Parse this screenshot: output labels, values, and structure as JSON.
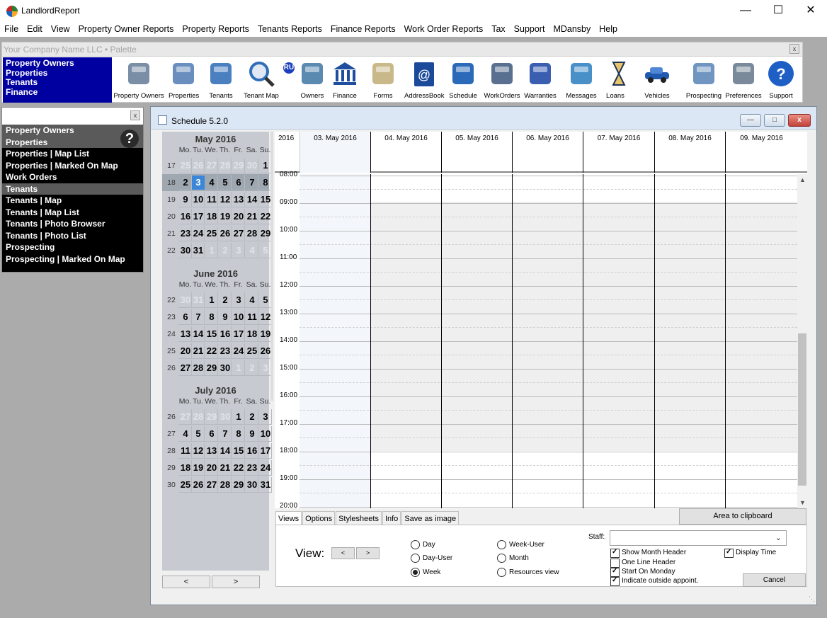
{
  "app": {
    "title": "LandlordReport",
    "minimize": "—",
    "maximize": "☐",
    "close": "✕"
  },
  "menu": [
    "File",
    "Edit",
    "View",
    "Property Owner Reports",
    "Property Reports",
    "Tenants Reports",
    "Finance Reports",
    "Work Order Reports",
    "Tax",
    "Support",
    "MDansby",
    "Help"
  ],
  "palette": {
    "title": "Your Company Name LLC  • Palette",
    "close": "x",
    "nav": [
      "Property Owners",
      "Properties",
      "Tenants",
      "Finance"
    ],
    "tools": [
      "Property Owners",
      "Properties",
      "Tenants",
      "Tenant Map",
      "RU",
      "Owners",
      "Finance",
      "Forms",
      "AddressBook",
      "Schedule",
      "WorkOrders",
      "Warranties",
      "Messages",
      "Loans",
      "Vehicles",
      "Prospecting",
      "Preferences",
      "Support"
    ]
  },
  "leftnav": {
    "close": "x",
    "help": "?",
    "items": [
      {
        "label": "Property Owners",
        "gray": true
      },
      {
        "label": "Properties",
        "gray": true
      },
      {
        "label": "Properties | Map List",
        "gray": false
      },
      {
        "label": "Properties | Marked On Map",
        "gray": false
      },
      {
        "label": "Work Orders",
        "gray": false
      },
      {
        "label": "Tenants",
        "gray": true
      },
      {
        "label": "Tenants | Map",
        "gray": false
      },
      {
        "label": "Tenants | Map List",
        "gray": false
      },
      {
        "label": "Tenants | Photo Browser",
        "gray": false
      },
      {
        "label": "Tenants | Photo List",
        "gray": false
      },
      {
        "label": "Prospecting",
        "gray": false
      },
      {
        "label": "Prospecting | Marked On Map",
        "gray": false
      }
    ]
  },
  "schedule": {
    "title": "Schedule 5.2.0",
    "win_min": "—",
    "win_max": "□",
    "win_close": "x",
    "dow": [
      "Mo.",
      "Tu.",
      "We.",
      "Th.",
      "Fr.",
      "Sa.",
      "Su."
    ],
    "months": [
      {
        "title": "May 2016",
        "weeks": [
          {
            "wk": "17",
            "days": [
              "25",
              "26",
              "27",
              "28",
              "29",
              "30",
              "1"
            ],
            "dim": [
              1,
              1,
              1,
              1,
              1,
              1,
              0
            ]
          },
          {
            "wk": "18",
            "days": [
              "2",
              "3",
              "4",
              "5",
              "6",
              "7",
              "8"
            ],
            "dim": [
              0,
              0,
              0,
              0,
              0,
              0,
              0
            ],
            "current": true,
            "today": 1
          },
          {
            "wk": "19",
            "days": [
              "9",
              "10",
              "11",
              "12",
              "13",
              "14",
              "15"
            ],
            "dim": [
              0,
              0,
              0,
              0,
              0,
              0,
              0
            ]
          },
          {
            "wk": "20",
            "days": [
              "16",
              "17",
              "18",
              "19",
              "20",
              "21",
              "22"
            ],
            "dim": [
              0,
              0,
              0,
              0,
              0,
              0,
              0
            ]
          },
          {
            "wk": "21",
            "days": [
              "23",
              "24",
              "25",
              "26",
              "27",
              "28",
              "29"
            ],
            "dim": [
              0,
              0,
              0,
              0,
              0,
              0,
              0
            ]
          },
          {
            "wk": "22",
            "days": [
              "30",
              "31",
              "1",
              "2",
              "3",
              "4",
              "5"
            ],
            "dim": [
              0,
              0,
              1,
              1,
              1,
              1,
              1
            ]
          }
        ]
      },
      {
        "title": "June 2016",
        "weeks": [
          {
            "wk": "22",
            "days": [
              "30",
              "31",
              "1",
              "2",
              "3",
              "4",
              "5"
            ],
            "dim": [
              1,
              1,
              0,
              0,
              0,
              0,
              0
            ]
          },
          {
            "wk": "23",
            "days": [
              "6",
              "7",
              "8",
              "9",
              "10",
              "11",
              "12"
            ],
            "dim": [
              0,
              0,
              0,
              0,
              0,
              0,
              0
            ]
          },
          {
            "wk": "24",
            "days": [
              "13",
              "14",
              "15",
              "16",
              "17",
              "18",
              "19"
            ],
            "dim": [
              0,
              0,
              0,
              0,
              0,
              0,
              0
            ]
          },
          {
            "wk": "25",
            "days": [
              "20",
              "21",
              "22",
              "23",
              "24",
              "25",
              "26"
            ],
            "dim": [
              0,
              0,
              0,
              0,
              0,
              0,
              0
            ]
          },
          {
            "wk": "26",
            "days": [
              "27",
              "28",
              "29",
              "30",
              "1",
              "2",
              "3"
            ],
            "dim": [
              0,
              0,
              0,
              0,
              1,
              1,
              1
            ]
          }
        ]
      },
      {
        "title": "July 2016",
        "weeks": [
          {
            "wk": "26",
            "days": [
              "27",
              "28",
              "29",
              "30",
              "1",
              "2",
              "3"
            ],
            "dim": [
              1,
              1,
              1,
              1,
              0,
              0,
              0
            ]
          },
          {
            "wk": "27",
            "days": [
              "4",
              "5",
              "6",
              "7",
              "8",
              "9",
              "10"
            ],
            "dim": [
              0,
              0,
              0,
              0,
              0,
              0,
              0
            ]
          },
          {
            "wk": "28",
            "days": [
              "11",
              "12",
              "13",
              "14",
              "15",
              "16",
              "17"
            ],
            "dim": [
              0,
              0,
              0,
              0,
              0,
              0,
              0
            ]
          },
          {
            "wk": "29",
            "days": [
              "18",
              "19",
              "20",
              "21",
              "22",
              "23",
              "24"
            ],
            "dim": [
              0,
              0,
              0,
              0,
              0,
              0,
              0
            ]
          },
          {
            "wk": "30",
            "days": [
              "25",
              "26",
              "27",
              "28",
              "29",
              "30",
              "31"
            ],
            "dim": [
              0,
              0,
              0,
              0,
              0,
              0,
              0
            ]
          }
        ]
      }
    ],
    "prev": "<",
    "next": ">",
    "year": "2016",
    "day_columns": [
      "03. May 2016",
      "04. May 2016",
      "05. May 2016",
      "06. May 2016",
      "07. May 2016",
      "08. May 2016",
      "09. May 2016"
    ],
    "hours": [
      "08:00",
      "09:00",
      "10:00",
      "11:00",
      "12:00",
      "13:00",
      "14:00",
      "15:00",
      "16:00",
      "17:00",
      "18:00",
      "19:00",
      "20:00"
    ],
    "tabs": [
      "Views",
      "Options",
      "Stylesheets",
      "Info",
      "Save as image"
    ],
    "area_to_clipboard": "Area to clipboard",
    "view_label": "View:",
    "view_prev": "<",
    "view_next": ">",
    "view_modes": [
      {
        "label": "Day",
        "selected": false
      },
      {
        "label": "Day-User",
        "selected": false
      },
      {
        "label": "Week",
        "selected": true
      },
      {
        "label": "Week-User",
        "selected": false
      },
      {
        "label": "Month",
        "selected": false
      },
      {
        "label": "Resources view",
        "selected": false
      }
    ],
    "staff_label": "Staff:",
    "staff_value": "",
    "checks": [
      {
        "label": "Show Month Header",
        "checked": true
      },
      {
        "label": "One Line Header",
        "checked": false
      },
      {
        "label": "Start On Monday",
        "checked": true
      },
      {
        "label": "Indicate outside appoint.",
        "checked": true
      },
      {
        "label": "Display Time",
        "checked": true
      }
    ],
    "cancel": "Cancel"
  }
}
